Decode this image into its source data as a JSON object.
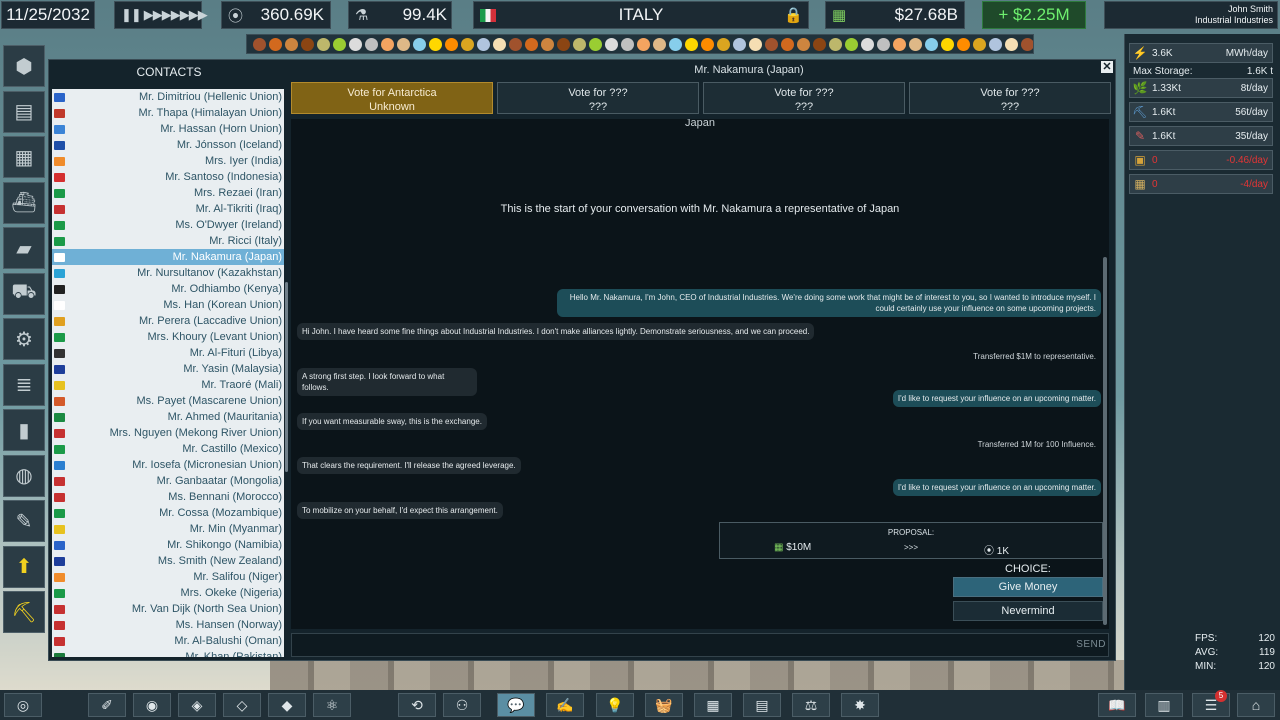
{
  "topbar": {
    "date": "11/25/2032",
    "influence": "360.69K",
    "research": "99.4K",
    "country": "ITALY",
    "money": "$27.68B",
    "income": "+ $2.25M",
    "user_name": "John Smith",
    "company": "Industrial Industries"
  },
  "panel": {
    "title": "Mr. Nakamura (Japan)",
    "contacts_title": "CONTACTS",
    "close": "✕"
  },
  "contacts": [
    {
      "name": "Mr. Dimitriou (Hellenic Union)",
      "color": "#2a64c9"
    },
    {
      "name": "Mr. Thapa (Himalayan Union)",
      "color": "#c0392b"
    },
    {
      "name": "Mr. Hassan (Horn Union)",
      "color": "#3b84d6"
    },
    {
      "name": "Mr. Jónsson (Iceland)",
      "color": "#1e4fa8"
    },
    {
      "name": "Mrs. Iyer (India)",
      "color": "#f08c2b"
    },
    {
      "name": "Mr. Santoso (Indonesia)",
      "color": "#d43030"
    },
    {
      "name": "Mrs. Rezaei (Iran)",
      "color": "#1b9a48"
    },
    {
      "name": "Mr. Al-Tikriti (Iraq)",
      "color": "#c63131"
    },
    {
      "name": "Ms. O'Dwyer (Ireland)",
      "color": "#1b9a48"
    },
    {
      "name": "Mr. Ricci (Italy)",
      "color": "#1b9a48"
    },
    {
      "name": "Mr. Nakamura (Japan)",
      "color": "#ffffff",
      "selected": true
    },
    {
      "name": "Mr. Nursultanov (Kazakhstan)",
      "color": "#2ba3d6"
    },
    {
      "name": "Mr. Odhiambo (Kenya)",
      "color": "#222222"
    },
    {
      "name": "Ms. Han (Korean Union)",
      "color": "#ffffff"
    },
    {
      "name": "Mr. Perera (Laccadive Union)",
      "color": "#e0a020"
    },
    {
      "name": "Mrs. Khoury (Levant Union)",
      "color": "#1b9a48"
    },
    {
      "name": "Mr. Al-Fituri (Libya)",
      "color": "#333333"
    },
    {
      "name": "Mr. Yasin (Malaysia)",
      "color": "#1e3e9a"
    },
    {
      "name": "Mr. Traoré (Mali)",
      "color": "#e7c21f"
    },
    {
      "name": "Ms. Payet (Mascarene Union)",
      "color": "#d45a2a"
    },
    {
      "name": "Mr. Ahmed (Mauritania)",
      "color": "#1b8a42"
    },
    {
      "name": "Mrs. Nguyen (Mekong River Union)",
      "color": "#c63131"
    },
    {
      "name": "Mr. Castillo (Mexico)",
      "color": "#1b9a48"
    },
    {
      "name": "Mr. Iosefa (Micronesian Union)",
      "color": "#2b7fd0"
    },
    {
      "name": "Mr. Ganbaatar (Mongolia)",
      "color": "#c63131"
    },
    {
      "name": "Ms. Bennani (Morocco)",
      "color": "#c63131"
    },
    {
      "name": "Mr. Cossa (Mozambique)",
      "color": "#1b9a48"
    },
    {
      "name": "Mr. Min (Myanmar)",
      "color": "#e7c21f"
    },
    {
      "name": "Mr. Shikongo (Namibia)",
      "color": "#2b64c9"
    },
    {
      "name": "Ms. Smith (New Zealand)",
      "color": "#1e3e9a"
    },
    {
      "name": "Mr. Salifou (Niger)",
      "color": "#f08c2b"
    },
    {
      "name": "Mrs. Okeke (Nigeria)",
      "color": "#1b9a48"
    },
    {
      "name": "Mr. Van Dijk (North Sea Union)",
      "color": "#c63131"
    },
    {
      "name": "Ms. Hansen (Norway)",
      "color": "#c63131"
    },
    {
      "name": "Mr. Al-Balushi (Oman)",
      "color": "#c63131"
    },
    {
      "name": "Mr. Khan (Pakistan)",
      "color": "#1b7a3c"
    }
  ],
  "vote_tabs": [
    {
      "line1": "Vote for Antarctica",
      "line2": "Unknown",
      "active": true
    },
    {
      "line1": "Vote for ???",
      "line2": "???"
    },
    {
      "line1": "Vote for ???",
      "line2": "???"
    },
    {
      "line1": "Vote for ???",
      "line2": "???"
    }
  ],
  "chat": {
    "country": "Japan",
    "intro": "This is the start of your conversation with Mr. Nakamura a representative of Japan",
    "messages": [
      {
        "type": "out",
        "text": "Hello Mr. Nakamura, I'm John, CEO of Industrial Industries. We're doing some work that might be of interest to you, so I wanted to introduce myself. I could certainly use your influence on some upcoming projects."
      },
      {
        "type": "in",
        "text": "Hi John. I have heard some fine things about Industrial Industries. I don't make alliances lightly. Demonstrate seriousness, and we can proceed."
      },
      {
        "type": "sys",
        "text": "Transferred $1M to representative."
      },
      {
        "type": "in",
        "text": "A strong first step. I look forward to what follows."
      },
      {
        "type": "out",
        "text": "I'd like to request your influence on an upcoming matter."
      },
      {
        "type": "in",
        "text": "If you want measurable sway, this is the exchange."
      },
      {
        "type": "sys",
        "text": "Transferred 1M for 100 Influence."
      },
      {
        "type": "in",
        "text": "That clears the requirement. I'll release the agreed leverage."
      },
      {
        "type": "out",
        "text": "I'd like to request your influence on an upcoming matter."
      },
      {
        "type": "in",
        "text": "To mobilize on your behalf, I'd expect this arrangement."
      }
    ],
    "proposal": {
      "title": "PROPOSAL:",
      "give": "$10M",
      "arrow": ">>>",
      "get": "1K"
    },
    "choice_label": "CHOICE:",
    "give_money": "Give Money",
    "nevermind": "Nevermind",
    "send": "SEND"
  },
  "right_panel": {
    "energy": {
      "value": "3.6K",
      "rate": "MWh/day"
    },
    "max_storage_label": "Max Storage:",
    "max_storage_value": "1.6K t",
    "resources": [
      {
        "value": "1.33Kt",
        "rate": "8t/day",
        "color": "#7fbf3f"
      },
      {
        "value": "1.6Kt",
        "rate": "56t/day",
        "color": "#5fa0d8"
      },
      {
        "value": "1.6Kt",
        "rate": "35t/day",
        "color": "#d85f5f"
      },
      {
        "value": "0",
        "rate": "-0.46/day",
        "color": "#d4a23a",
        "negative": true
      },
      {
        "value": "0",
        "rate": "-4/day",
        "color": "#d4b060",
        "negative": true
      }
    ],
    "fps_label": "FPS:",
    "fps": "120",
    "avg_label": "AVG:",
    "avg": "119",
    "min_label": "MIN:",
    "min": "120"
  },
  "bottombar": {
    "notifications_badge": "5"
  }
}
